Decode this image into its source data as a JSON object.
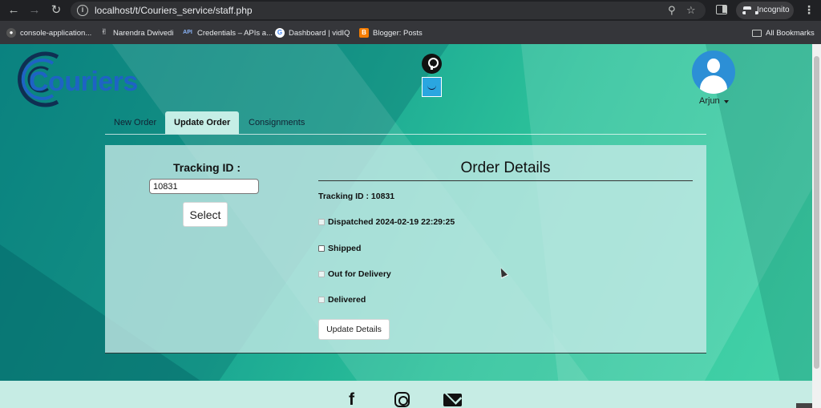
{
  "browser": {
    "url": "localhost/t/Couriers_service/staff.php",
    "incognito_label": "Incognito",
    "bookmarks": [
      {
        "label": "console-application...",
        "icon": "github-icon"
      },
      {
        "label": "Narendra Dwivedi",
        "icon": "person-icon"
      },
      {
        "label": "Credentials – APIs a...",
        "icon": "api-icon"
      },
      {
        "label": "Dashboard | vidIQ",
        "icon": "google-icon"
      },
      {
        "label": "Blogger: Posts",
        "icon": "blogger-icon"
      }
    ],
    "all_bookmarks_label": "All Bookmarks"
  },
  "site": {
    "logo_text": "Couriers",
    "user_name": "Arjun"
  },
  "tabs": [
    {
      "label": "New Order",
      "active": false
    },
    {
      "label": "Update Order",
      "active": true
    },
    {
      "label": "Consignments",
      "active": false
    }
  ],
  "tracking": {
    "label": "Tracking ID :",
    "value": "10831",
    "select_label": "Select"
  },
  "order_details": {
    "title": "Order Details",
    "tracking_line": "Tracking ID : 10831",
    "statuses": [
      {
        "label": "Dispatched 2024-02-19 22:29:25",
        "checked": true
      },
      {
        "label": "Shipped",
        "checked": false
      },
      {
        "label": "Out for Delivery",
        "checked": false
      },
      {
        "label": "Delivered",
        "checked": false
      }
    ],
    "update_label": "Update Details"
  },
  "footer": {
    "facebook_glyph": "f"
  },
  "colors": {
    "brand_blue": "#1e63c4",
    "bg_teal": "#1aa692",
    "bg_mint": "#46d3a9"
  }
}
